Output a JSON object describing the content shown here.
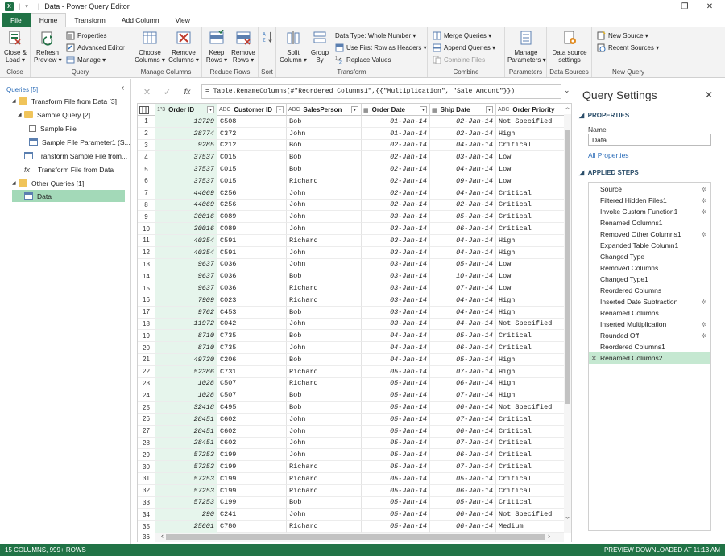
{
  "window": {
    "title": "Data - Power Query Editor",
    "app_logo": "X",
    "sep": "|",
    "qat_dropdown": "▾",
    "btn_restore": "❐",
    "btn_close": "✕"
  },
  "tabs": [
    "File",
    "Home",
    "Transform",
    "Add Column",
    "View"
  ],
  "ribbon": {
    "close_load": "Close &",
    "close_load2": "Load",
    "refresh": "Refresh",
    "refresh2": "Preview",
    "properties": "Properties",
    "advanced_editor": "Advanced Editor",
    "manage": "Manage",
    "choose_columns": "Choose",
    "choose_columns2": "Columns",
    "remove_columns": "Remove",
    "remove_columns2": "Columns",
    "keep_rows": "Keep",
    "keep_rows2": "Rows",
    "remove_rows": "Remove",
    "remove_rows2": "Rows",
    "split_column": "Split",
    "split_column2": "Column",
    "group_by": "Group",
    "group_by2": "By",
    "data_type": "Data Type: Whole Number",
    "first_row": "Use First Row as Headers",
    "replace_values": "Replace Values",
    "merge_queries": "Merge Queries",
    "append_queries": "Append Queries",
    "combine_files": "Combine Files",
    "manage_parameters": "Manage",
    "manage_parameters2": "Parameters",
    "data_source_settings": "Data source",
    "data_source_settings2": "settings",
    "new_source": "New Source",
    "recent_sources": "Recent Sources",
    "groups": [
      "Close",
      "Query",
      "Manage Columns",
      "Reduce Rows",
      "Sort",
      "Transform",
      "Combine",
      "Parameters",
      "Data Sources",
      "New Query"
    ]
  },
  "queries": {
    "header": "Queries [5]",
    "collapse": "‹",
    "items": [
      {
        "label": "Transform File from Data [3]"
      },
      {
        "label": "Sample Query [2]"
      },
      {
        "label": "Sample File"
      },
      {
        "label": "Sample File Parameter1 (S..."
      },
      {
        "label": "Transform Sample File from..."
      },
      {
        "label": "Transform File from Data"
      },
      {
        "label": "Other Queries [1]"
      },
      {
        "label": "Data"
      }
    ]
  },
  "formula": {
    "text": "= Table.RenameColumns(#\"Reordered Columns1\",{{\"Multiplication\", \"Sale Amount\"}})",
    "cancel": "✕",
    "commit": "✓",
    "fx": "fx",
    "expand": "⌄"
  },
  "grid": {
    "columns": [
      {
        "type": "1²3",
        "name": "Order ID"
      },
      {
        "type": "ABC",
        "name": "Customer ID"
      },
      {
        "type": "ABC",
        "name": "SalesPerson"
      },
      {
        "type": "▦",
        "name": "Order Date"
      },
      {
        "type": "▦",
        "name": "Ship Date"
      },
      {
        "type": "ABC",
        "name": "Order Priority"
      }
    ],
    "rows": [
      [
        "1",
        "13729",
        "C508",
        "Bob",
        "01-Jan-14",
        "02-Jan-14",
        "Not Specified"
      ],
      [
        "2",
        "28774",
        "C372",
        "John",
        "01-Jan-14",
        "02-Jan-14",
        "High"
      ],
      [
        "3",
        "9285",
        "C212",
        "Bob",
        "02-Jan-14",
        "04-Jan-14",
        "Critical"
      ],
      [
        "4",
        "37537",
        "C015",
        "Bob",
        "02-Jan-14",
        "03-Jan-14",
        "Low"
      ],
      [
        "5",
        "37537",
        "C015",
        "Bob",
        "02-Jan-14",
        "04-Jan-14",
        "Low"
      ],
      [
        "6",
        "37537",
        "C015",
        "Richard",
        "02-Jan-14",
        "09-Jan-14",
        "Low"
      ],
      [
        "7",
        "44069",
        "C256",
        "John",
        "02-Jan-14",
        "04-Jan-14",
        "Critical"
      ],
      [
        "8",
        "44069",
        "C256",
        "John",
        "02-Jan-14",
        "02-Jan-14",
        "Critical"
      ],
      [
        "9",
        "30016",
        "C089",
        "John",
        "03-Jan-14",
        "05-Jan-14",
        "Critical"
      ],
      [
        "10",
        "30016",
        "C089",
        "John",
        "03-Jan-14",
        "06-Jan-14",
        "Critical"
      ],
      [
        "11",
        "40354",
        "C591",
        "Richard",
        "03-Jan-14",
        "04-Jan-14",
        "High"
      ],
      [
        "12",
        "40354",
        "C591",
        "John",
        "03-Jan-14",
        "04-Jan-14",
        "High"
      ],
      [
        "13",
        "9637",
        "C036",
        "John",
        "03-Jan-14",
        "05-Jan-14",
        "Low"
      ],
      [
        "14",
        "9637",
        "C036",
        "Bob",
        "03-Jan-14",
        "10-Jan-14",
        "Low"
      ],
      [
        "15",
        "9637",
        "C036",
        "Richard",
        "03-Jan-14",
        "07-Jan-14",
        "Low"
      ],
      [
        "16",
        "7909",
        "C023",
        "Richard",
        "03-Jan-14",
        "04-Jan-14",
        "High"
      ],
      [
        "17",
        "9762",
        "C453",
        "Bob",
        "03-Jan-14",
        "04-Jan-14",
        "High"
      ],
      [
        "18",
        "11972",
        "C042",
        "John",
        "03-Jan-14",
        "04-Jan-14",
        "Not Specified"
      ],
      [
        "19",
        "8710",
        "C735",
        "Bob",
        "04-Jan-14",
        "05-Jan-14",
        "Critical"
      ],
      [
        "20",
        "8710",
        "C735",
        "John",
        "04-Jan-14",
        "06-Jan-14",
        "Critical"
      ],
      [
        "21",
        "49730",
        "C206",
        "Bob",
        "04-Jan-14",
        "05-Jan-14",
        "High"
      ],
      [
        "22",
        "52386",
        "C731",
        "Richard",
        "05-Jan-14",
        "07-Jan-14",
        "High"
      ],
      [
        "23",
        "1028",
        "C507",
        "Richard",
        "05-Jan-14",
        "06-Jan-14",
        "High"
      ],
      [
        "24",
        "1028",
        "C507",
        "Bob",
        "05-Jan-14",
        "07-Jan-14",
        "High"
      ],
      [
        "25",
        "32418",
        "C495",
        "Bob",
        "05-Jan-14",
        "06-Jan-14",
        "Not Specified"
      ],
      [
        "26",
        "28451",
        "C602",
        "John",
        "05-Jan-14",
        "07-Jan-14",
        "Critical"
      ],
      [
        "27",
        "28451",
        "C602",
        "John",
        "05-Jan-14",
        "06-Jan-14",
        "Critical"
      ],
      [
        "28",
        "28451",
        "C602",
        "John",
        "05-Jan-14",
        "07-Jan-14",
        "Critical"
      ],
      [
        "29",
        "57253",
        "C199",
        "John",
        "05-Jan-14",
        "06-Jan-14",
        "Critical"
      ],
      [
        "30",
        "57253",
        "C199",
        "Richard",
        "05-Jan-14",
        "07-Jan-14",
        "Critical"
      ],
      [
        "31",
        "57253",
        "C199",
        "Richard",
        "05-Jan-14",
        "05-Jan-14",
        "Critical"
      ],
      [
        "32",
        "57253",
        "C199",
        "Richard",
        "05-Jan-14",
        "06-Jan-14",
        "Critical"
      ],
      [
        "33",
        "57253",
        "C199",
        "Bob",
        "05-Jan-14",
        "05-Jan-14",
        "Critical"
      ],
      [
        "34",
        "290",
        "C241",
        "John",
        "05-Jan-14",
        "06-Jan-14",
        "Not Specified"
      ],
      [
        "35",
        "25601",
        "C780",
        "Richard",
        "05-Jan-14",
        "06-Jan-14",
        "Medium"
      ]
    ],
    "last_row_number": "36"
  },
  "settings": {
    "title": "Query Settings",
    "close": "✕",
    "properties": "PROPERTIES",
    "name_label": "Name",
    "name_value": "Data",
    "all_properties": "All Properties",
    "applied_steps": "APPLIED STEPS",
    "steps": [
      {
        "label": "Source",
        "gear": true
      },
      {
        "label": "Filtered Hidden Files1",
        "gear": true
      },
      {
        "label": "Invoke Custom Function1",
        "gear": true
      },
      {
        "label": "Renamed Columns1",
        "gear": false
      },
      {
        "label": "Removed Other Columns1",
        "gear": true
      },
      {
        "label": "Expanded Table Column1",
        "gear": false
      },
      {
        "label": "Changed Type",
        "gear": false
      },
      {
        "label": "Removed Columns",
        "gear": false
      },
      {
        "label": "Changed Type1",
        "gear": false
      },
      {
        "label": "Reordered Columns",
        "gear": false
      },
      {
        "label": "Inserted Date Subtraction",
        "gear": true
      },
      {
        "label": "Renamed Columns",
        "gear": false
      },
      {
        "label": "Inserted Multiplication",
        "gear": true
      },
      {
        "label": "Rounded Off",
        "gear": true
      },
      {
        "label": "Reordered Columns1",
        "gear": false
      },
      {
        "label": "Renamed Columns2",
        "gear": false
      }
    ]
  },
  "status": {
    "left": "15 COLUMNS, 999+ ROWS",
    "right": "PREVIEW DOWNLOADED AT 11:13 AM"
  },
  "colors": {
    "excel_green": "#217346",
    "selected_green": "#a3d9b8",
    "link_blue": "#2b6cb8"
  }
}
